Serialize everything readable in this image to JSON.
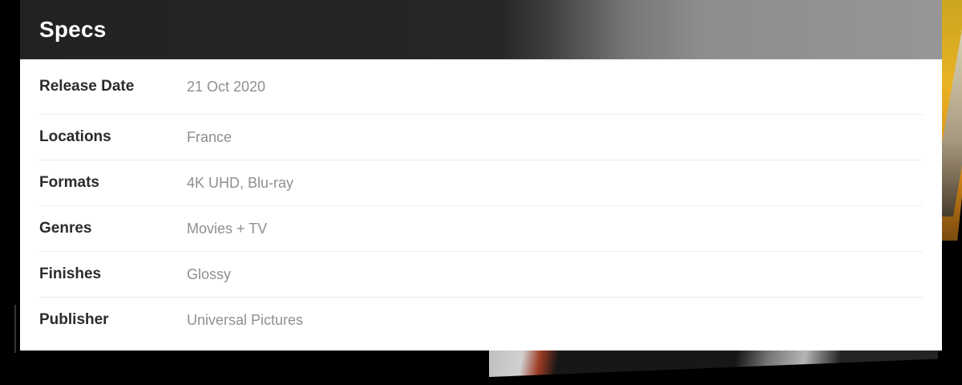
{
  "specs": {
    "title": "Specs",
    "rows": [
      {
        "label": "Release Date",
        "value": "21 Oct 2020"
      },
      {
        "label": "Locations",
        "value": "France"
      },
      {
        "label": "Formats",
        "value": "4K UHD, Blu-ray"
      },
      {
        "label": "Genres",
        "value": "Movies + TV"
      },
      {
        "label": "Finishes",
        "value": "Glossy"
      },
      {
        "label": "Publisher",
        "value": "Universal Pictures"
      }
    ]
  },
  "theme": {
    "header_dark": "#222222",
    "header_light": "#969696",
    "label_color": "#2b2b2b",
    "value_color": "#8f8f8f",
    "divider": "#ececec"
  }
}
